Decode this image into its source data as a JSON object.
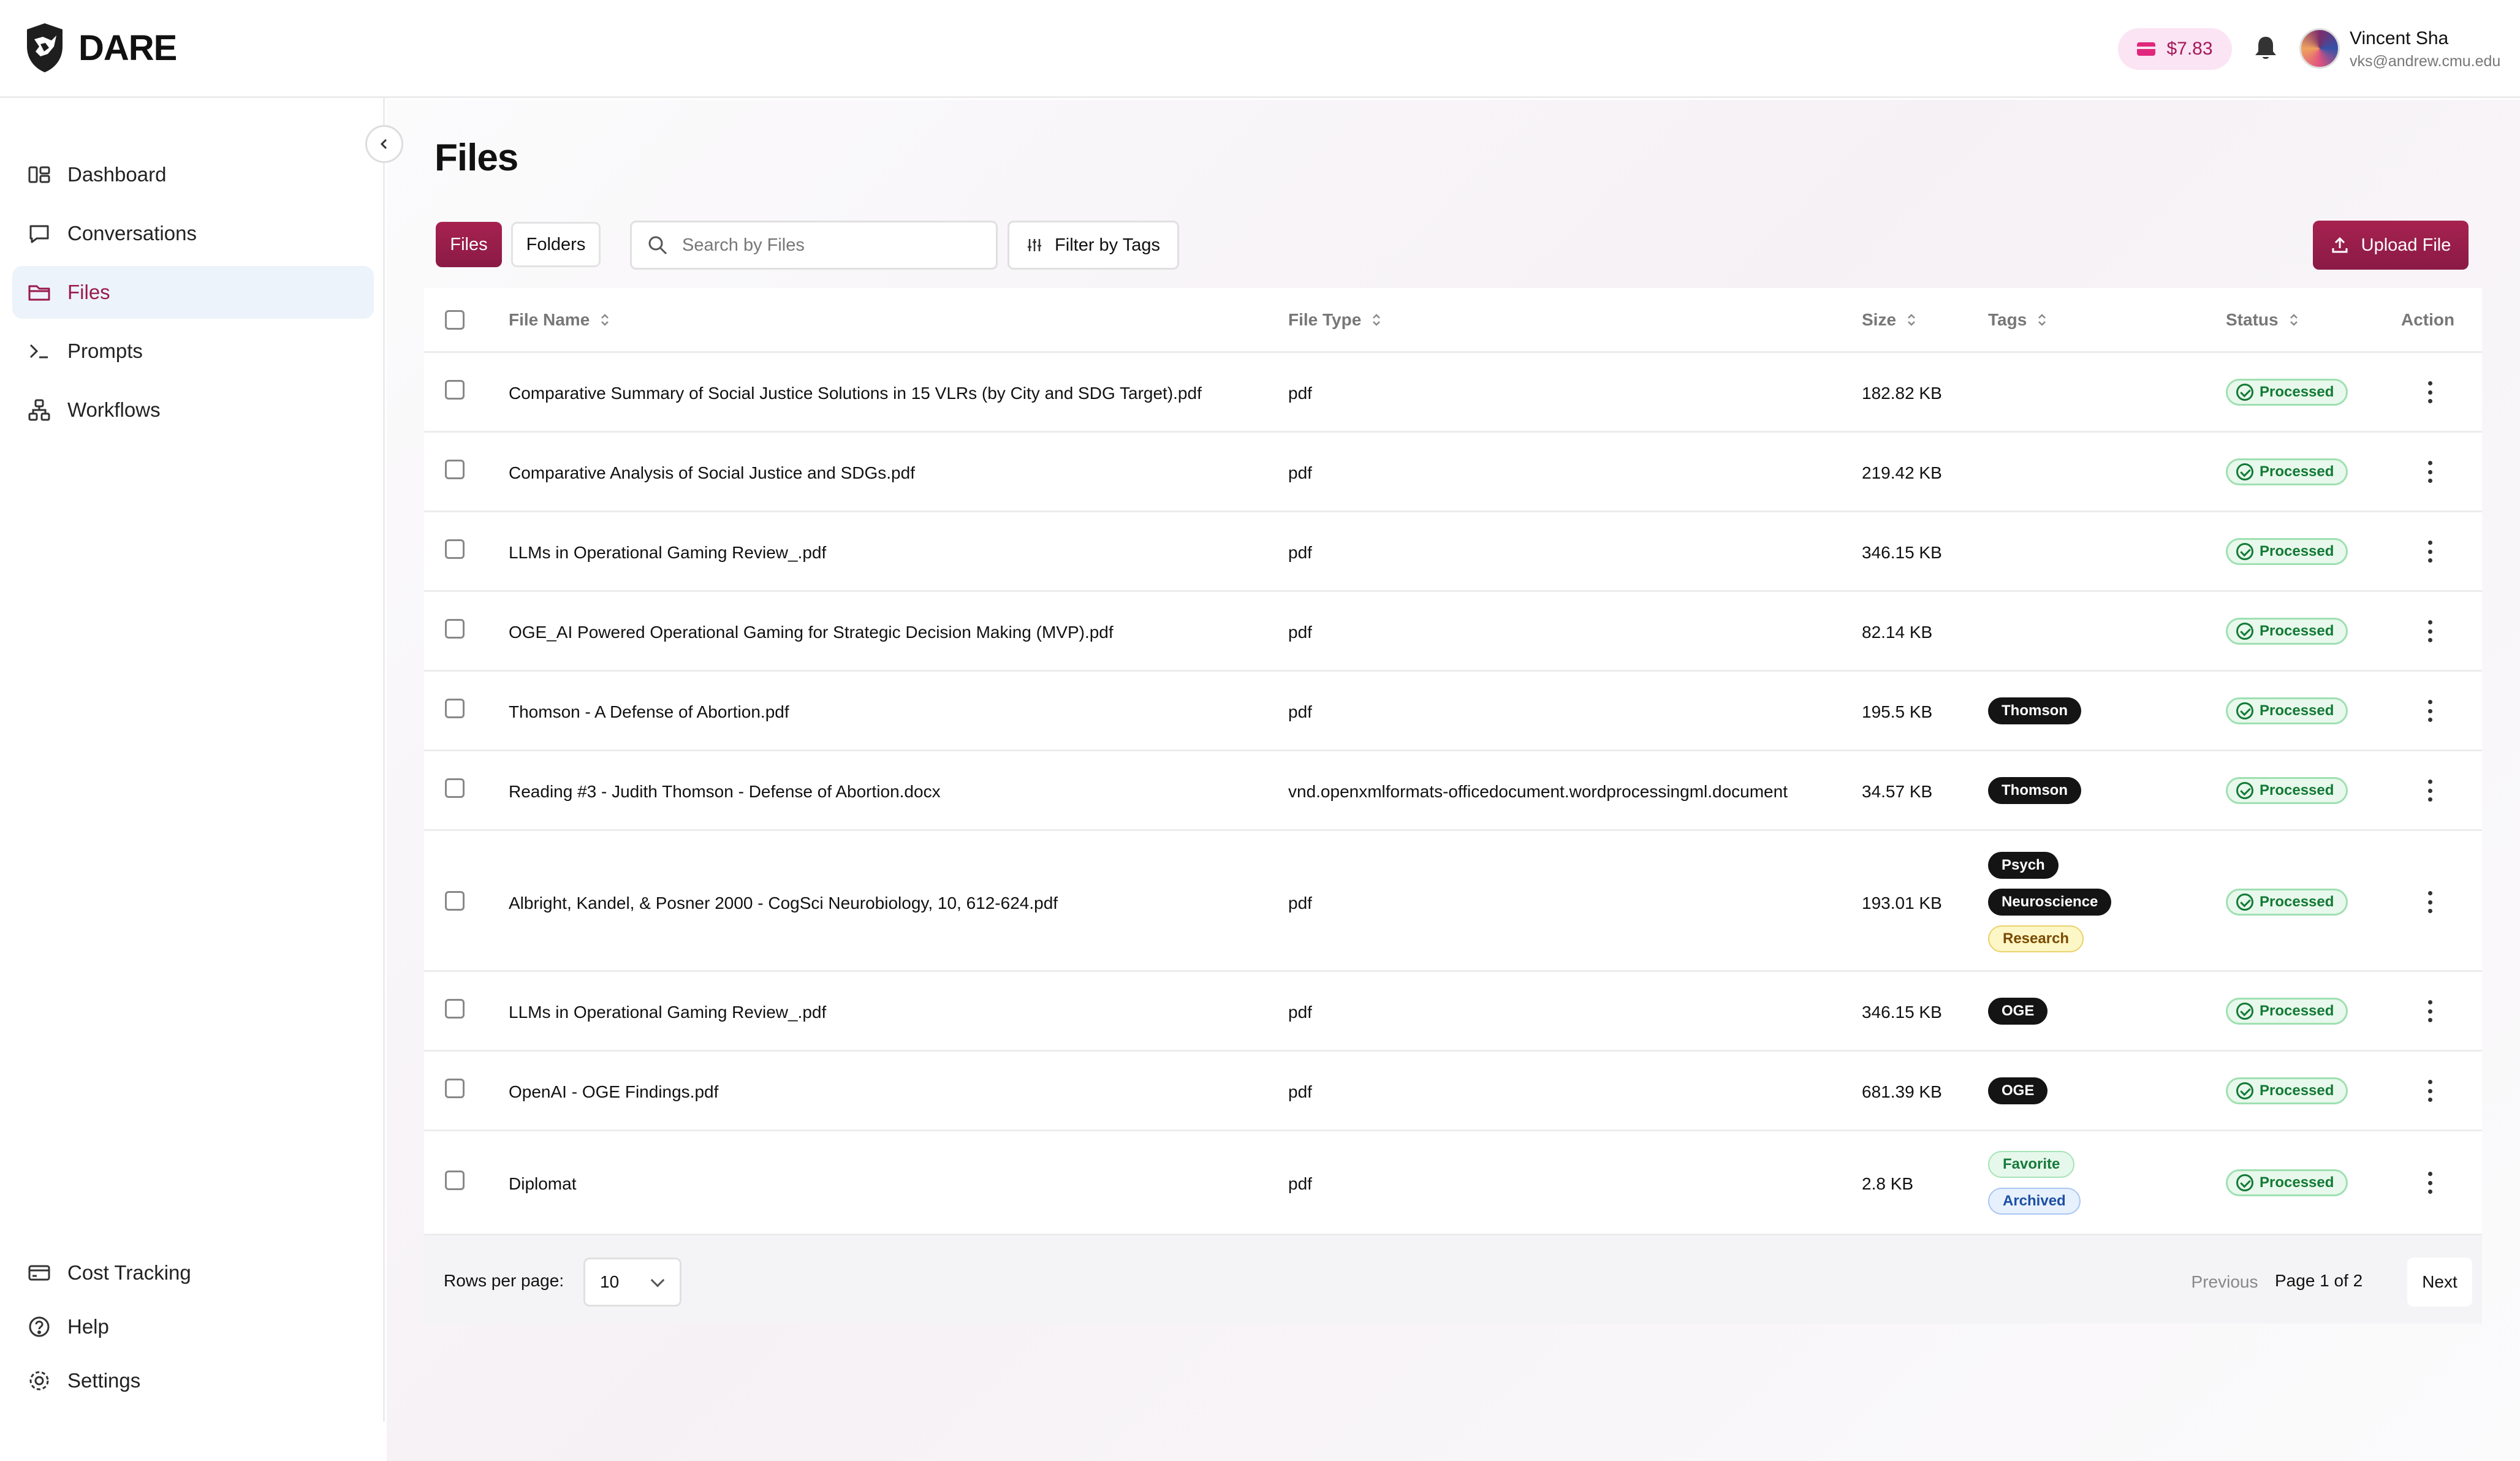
{
  "app": {
    "name": "DARE"
  },
  "header": {
    "credit_balance": "$7.83",
    "user": {
      "name": "Vincent Sha",
      "email": "vks@andrew.cmu.edu"
    }
  },
  "sidebar": {
    "items": [
      {
        "label": "Dashboard",
        "icon": "dashboard-icon",
        "active": false
      },
      {
        "label": "Conversations",
        "icon": "chat-bubble-icon",
        "active": false
      },
      {
        "label": "Files",
        "icon": "folder-icon",
        "active": true
      },
      {
        "label": "Prompts",
        "icon": "terminal-prompt-icon",
        "active": false
      },
      {
        "label": "Workflows",
        "icon": "workflow-icon",
        "active": false
      }
    ],
    "bottom_items": [
      {
        "label": "Cost Tracking",
        "icon": "credit-card-icon"
      },
      {
        "label": "Help",
        "icon": "help-circle-icon"
      },
      {
        "label": "Settings",
        "icon": "gear-icon"
      }
    ]
  },
  "main": {
    "title": "Files",
    "view_toggle": {
      "files": "Files",
      "folders": "Folders"
    },
    "search": {
      "placeholder": "Search by Files",
      "value": ""
    },
    "filter_label": "Filter by Tags",
    "upload_label": "Upload File",
    "columns": {
      "file_name": "File Name",
      "file_type": "File Type",
      "size": "Size",
      "tags": "Tags",
      "status": "Status",
      "action": "Action"
    },
    "rows": [
      {
        "name": "Comparative Summary of Social Justice Solutions in 15 VLRs (by City and SDG Target).pdf",
        "type": "pdf",
        "size": "182.82 KB",
        "tags": [],
        "status": "Processed"
      },
      {
        "name": "Comparative Analysis of Social Justice and SDGs.pdf",
        "type": "pdf",
        "size": "219.42 KB",
        "tags": [],
        "status": "Processed"
      },
      {
        "name": "LLMs in Operational Gaming Review_.pdf",
        "type": "pdf",
        "size": "346.15 KB",
        "tags": [],
        "status": "Processed"
      },
      {
        "name": "OGE_AI Powered Operational Gaming for Strategic Decision Making (MVP).pdf",
        "type": "pdf",
        "size": "82.14 KB",
        "tags": [],
        "status": "Processed"
      },
      {
        "name": "Thomson - A Defense of Abortion.pdf",
        "type": "pdf",
        "size": "195.5 KB",
        "tags": [
          {
            "label": "Thomson",
            "style": "dark"
          }
        ],
        "status": "Processed"
      },
      {
        "name": "Reading #3 - Judith Thomson - Defense of Abortion.docx",
        "type": "vnd.openxmlformats-officedocument.wordprocessingml.document",
        "size": "34.57 KB",
        "tags": [
          {
            "label": "Thomson",
            "style": "dark"
          }
        ],
        "status": "Processed"
      },
      {
        "name": "Albright, Kandel, & Posner 2000 - CogSci Neurobiology, 10, 612-624.pdf",
        "type": "pdf",
        "size": "193.01 KB",
        "tags": [
          {
            "label": "Psych",
            "style": "dark"
          },
          {
            "label": "Neuroscience",
            "style": "dark"
          },
          {
            "label": "Research",
            "style": "yellow"
          }
        ],
        "status": "Processed"
      },
      {
        "name": "LLMs in Operational Gaming Review_.pdf",
        "type": "pdf",
        "size": "346.15 KB",
        "tags": [
          {
            "label": "OGE",
            "style": "dark"
          }
        ],
        "status": "Processed"
      },
      {
        "name": "OpenAI - OGE Findings.pdf",
        "type": "pdf",
        "size": "681.39 KB",
        "tags": [
          {
            "label": "OGE",
            "style": "dark"
          }
        ],
        "status": "Processed"
      },
      {
        "name": "Diplomat",
        "type": "pdf",
        "size": "2.8 KB",
        "tags": [
          {
            "label": "Favorite",
            "style": "green"
          },
          {
            "label": "Archived",
            "style": "blue"
          }
        ],
        "status": "Processed"
      }
    ],
    "pagination": {
      "rows_per_page_label": "Rows per page:",
      "rows_per_page": "10",
      "previous": "Previous",
      "page_info": "Page 1 of 2",
      "next": "Next"
    }
  },
  "colors": {
    "brand": "#9b1a4b",
    "processed": "#137a35",
    "active_nav_bg": "#edf3fb"
  }
}
